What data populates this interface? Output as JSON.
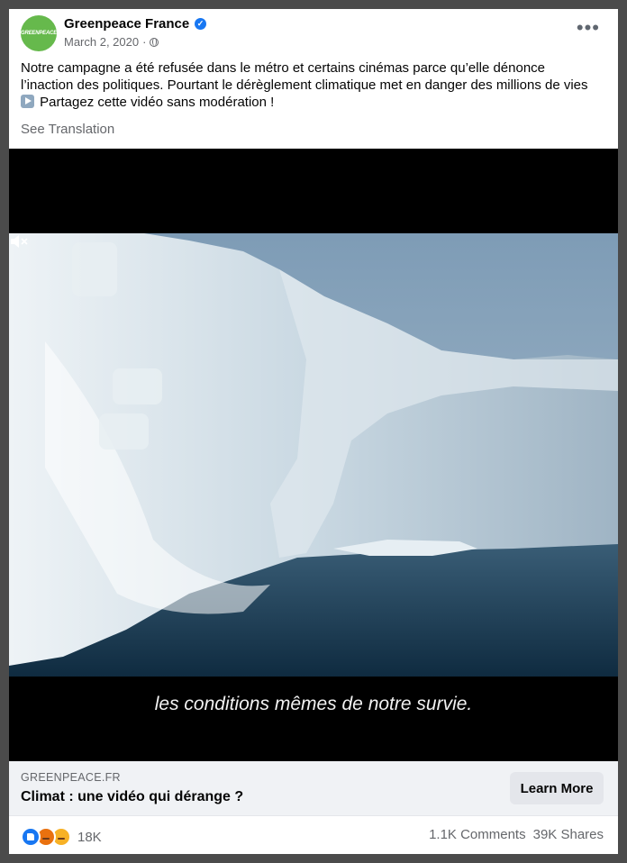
{
  "post": {
    "page_name": "Greenpeace France",
    "avatar_text": "GREENPEACE",
    "date": "March 2, 2020",
    "separator": "·",
    "text_part1": "Notre campagne a été refusée dans le métro et certains cinémas parce qu’elle dénonce l’inaction des politiques. Pourtant le dérèglement climatique met en danger des millions de vies ",
    "text_part2": " Partagez cette vidéo sans modération !",
    "see_translation": "See Translation"
  },
  "video": {
    "subtitle": "les conditions mêmes de notre survie."
  },
  "link_preview": {
    "domain": "GREENPEACE.FR",
    "title": "Climat : une vidéo qui dérange ?",
    "cta": "Learn More"
  },
  "footer": {
    "reaction_count": "18K",
    "comments": "1.1K Comments",
    "shares": "39K Shares"
  },
  "colors": {
    "accent": "#1877f2",
    "brand_green": "#66b94c"
  },
  "icons": [
    "verified-badge-icon",
    "globe-icon",
    "more-options-icon",
    "play-button-emoji-icon",
    "mute-icon",
    "like-reaction-icon",
    "angry-reaction-icon",
    "sad-reaction-icon"
  ]
}
